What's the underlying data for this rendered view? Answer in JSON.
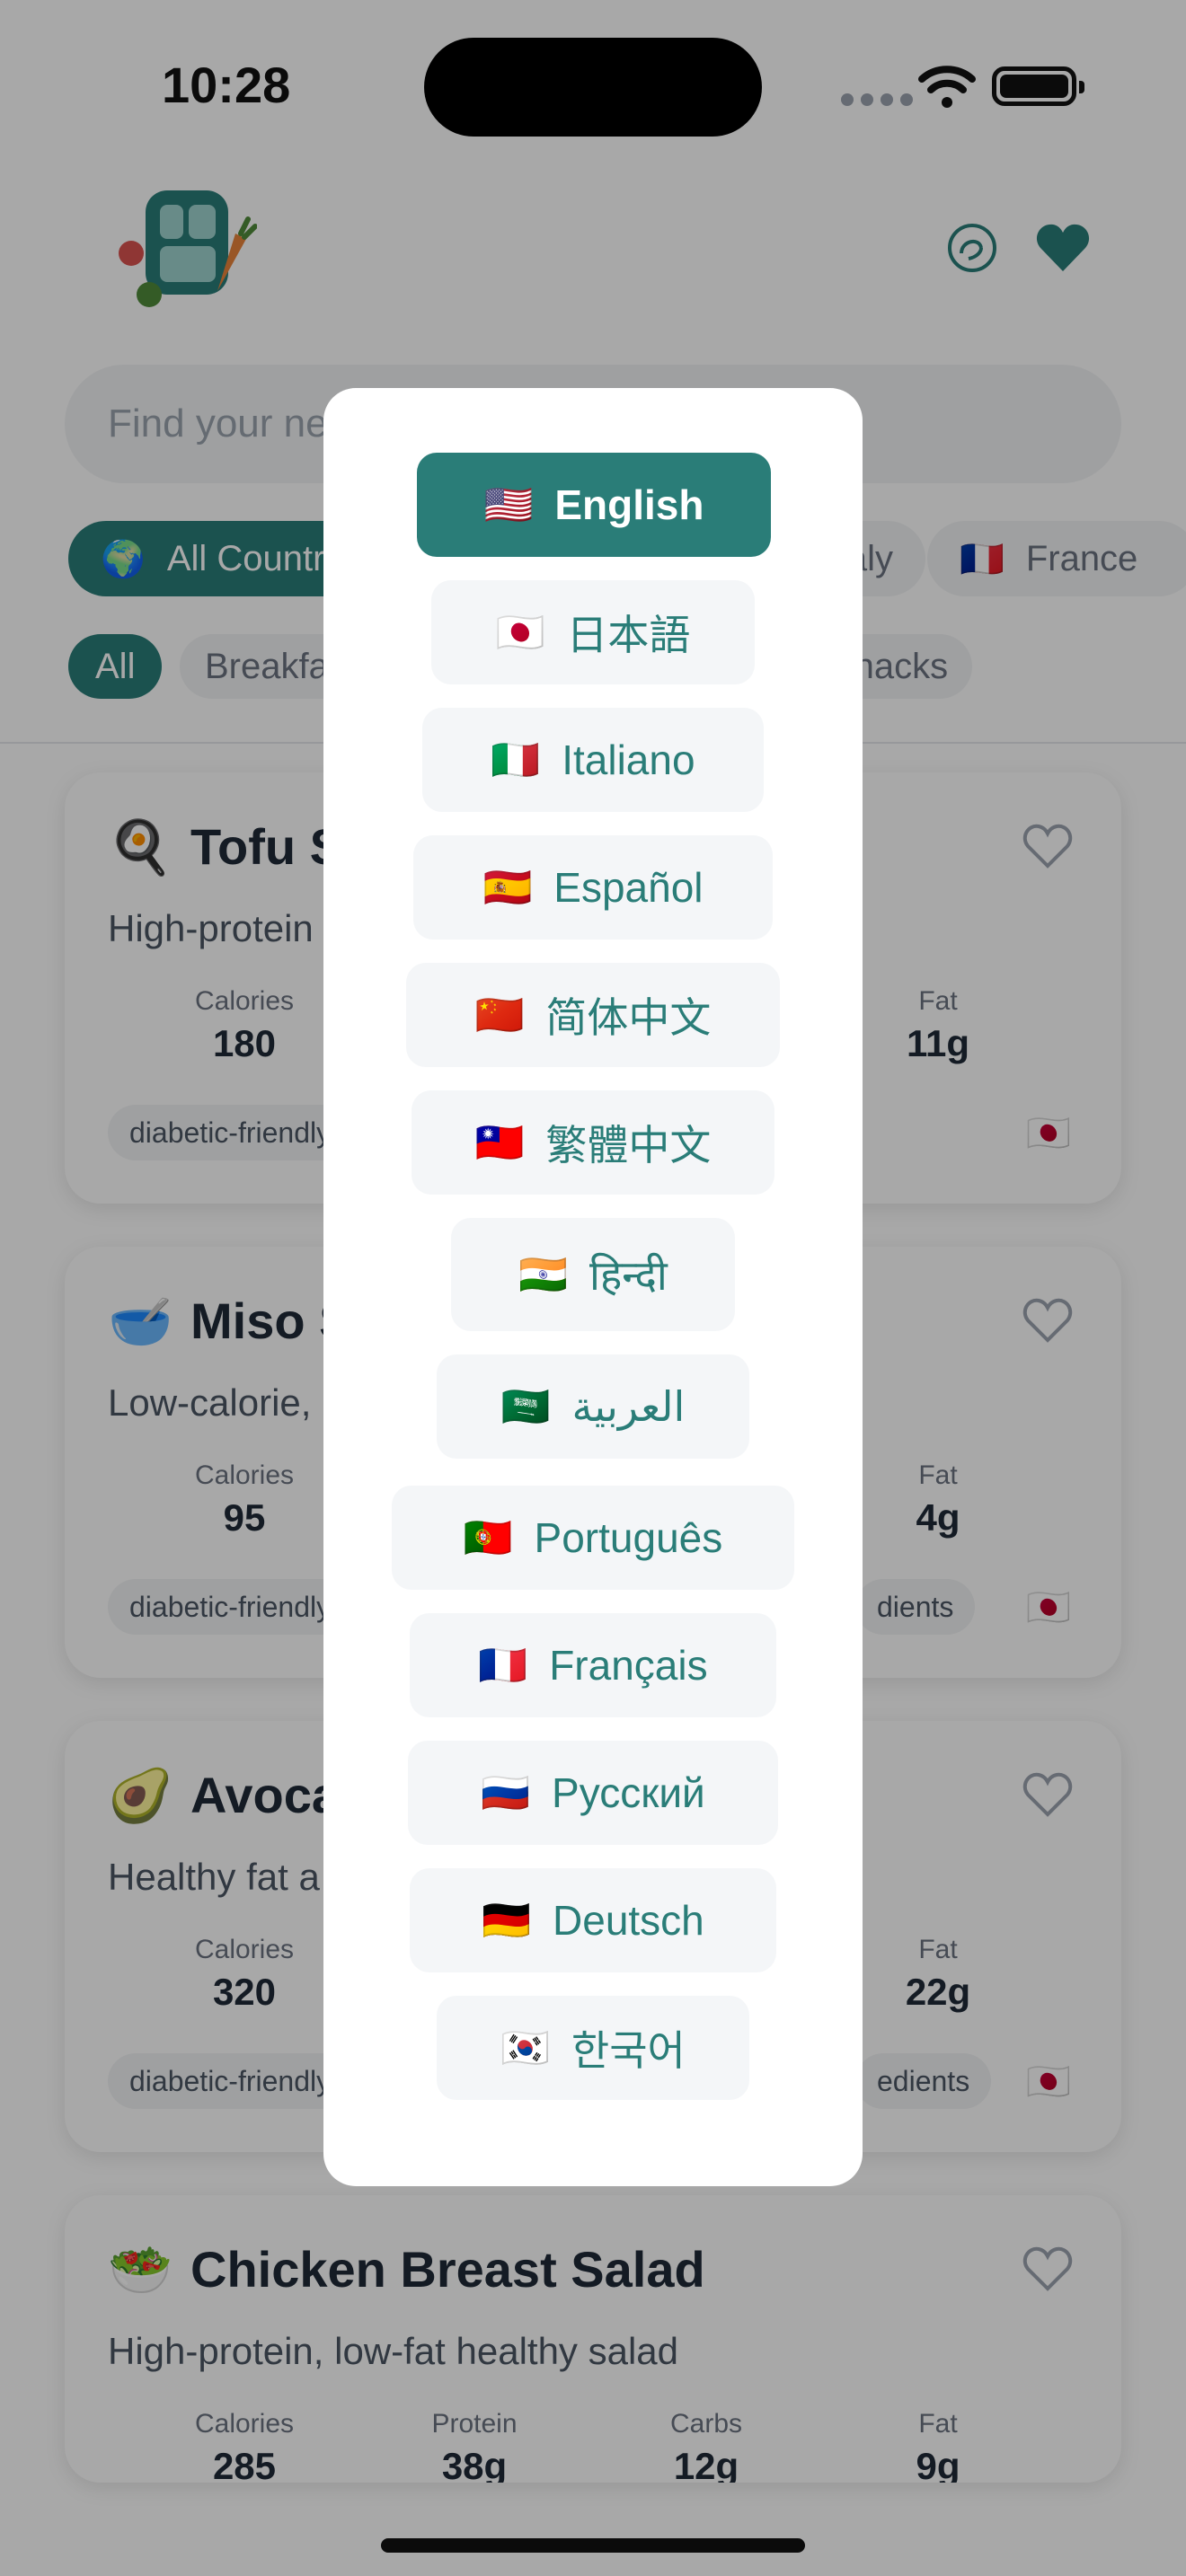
{
  "status": {
    "time": "10:28"
  },
  "search": {
    "placeholder": "Find your next delicious recipes..."
  },
  "filters": {
    "countries": [
      {
        "flag": "🌍",
        "label": "All Countries",
        "active": true
      },
      {
        "flag": "",
        "label": "Italy",
        "active": false
      },
      {
        "flag": "🇫🇷",
        "label": "France",
        "active": false
      }
    ],
    "meals": [
      {
        "label": "All",
        "active": true
      },
      {
        "label": "Breakfast",
        "active": false
      },
      {
        "label": "Snacks",
        "active": false
      }
    ]
  },
  "stat_labels": {
    "calories": "Calories",
    "protein": "Protein",
    "carbs": "Carbs",
    "fat": "Fat"
  },
  "recipes": [
    {
      "emoji": "🍳",
      "title": "Tofu S",
      "desc": "High-protein",
      "calories": "180",
      "fat": "11g",
      "tags": [
        "diabetic-friendly"
      ],
      "flag": "🇯🇵"
    },
    {
      "emoji": "🥣",
      "title": "Miso S",
      "desc": "Low-calorie,",
      "calories": "95",
      "fat": "4g",
      "tags": [
        "diabetic-friendly",
        "dients"
      ],
      "flag": "🇯🇵"
    },
    {
      "emoji": "🥑",
      "title": "Avoca",
      "desc": "Healthy fat a",
      "calories": "320",
      "fat": "22g",
      "tags": [
        "diabetic-friendly",
        "edients"
      ],
      "flag": "🇯🇵"
    },
    {
      "emoji": "🥗",
      "title": "Chicken Breast Salad",
      "desc": "High-protein, low-fat healthy salad",
      "calories": "285",
      "protein": "38g",
      "carbs": "12g",
      "fat": "9g"
    }
  ],
  "language_modal": {
    "languages": [
      {
        "flag": "🇺🇸",
        "label": "English",
        "selected": true
      },
      {
        "flag": "🇯🇵",
        "label": "日本語",
        "selected": false
      },
      {
        "flag": "🇮🇹",
        "label": "Italiano",
        "selected": false
      },
      {
        "flag": "🇪🇸",
        "label": "Español",
        "selected": false
      },
      {
        "flag": "🇨🇳",
        "label": "简体中文",
        "selected": false
      },
      {
        "flag": "🇹🇼",
        "label": "繁體中文",
        "selected": false
      },
      {
        "flag": "🇮🇳",
        "label": "हिन्दी",
        "selected": false
      },
      {
        "flag": "🇸🇦",
        "label": "العربية",
        "selected": false
      },
      {
        "flag": "🇵🇹",
        "label": "Português",
        "selected": false
      },
      {
        "flag": "🇫🇷",
        "label": "Français",
        "selected": false
      },
      {
        "flag": "🇷🇺",
        "label": "Русский",
        "selected": false
      },
      {
        "flag": "🇩🇪",
        "label": "Deutsch",
        "selected": false
      },
      {
        "flag": "🇰🇷",
        "label": "한국어",
        "selected": false
      }
    ]
  },
  "colors": {
    "accent": "#2a7d78",
    "chip_bg": "#f1f3f4",
    "scrim": "rgba(0,0,0,0.34)"
  }
}
